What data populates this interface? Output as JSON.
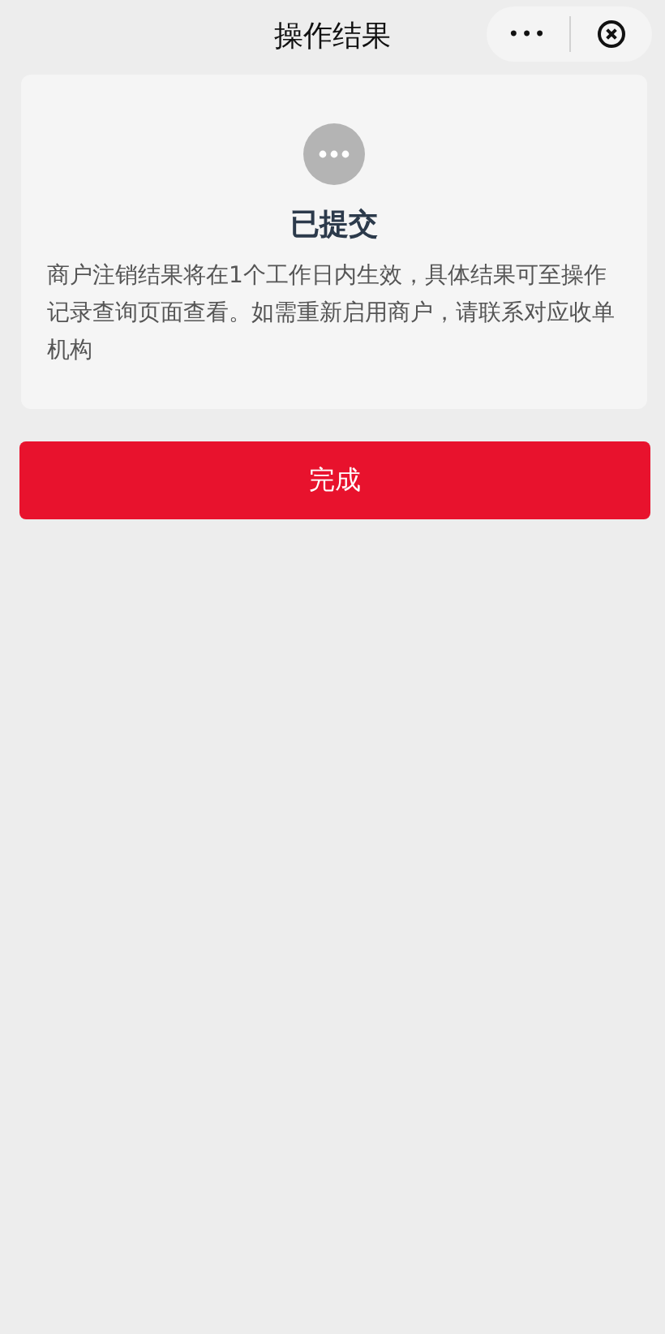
{
  "nav": {
    "title": "操作结果",
    "more": "•••"
  },
  "result": {
    "pending": true,
    "title": "已提交",
    "message": "商户注销结果将在1个工作日内生效，具体结果可至操作记录查询页面查看。如需重新启用商户，请联系对应收单机构"
  },
  "button": {
    "label": "完成"
  }
}
